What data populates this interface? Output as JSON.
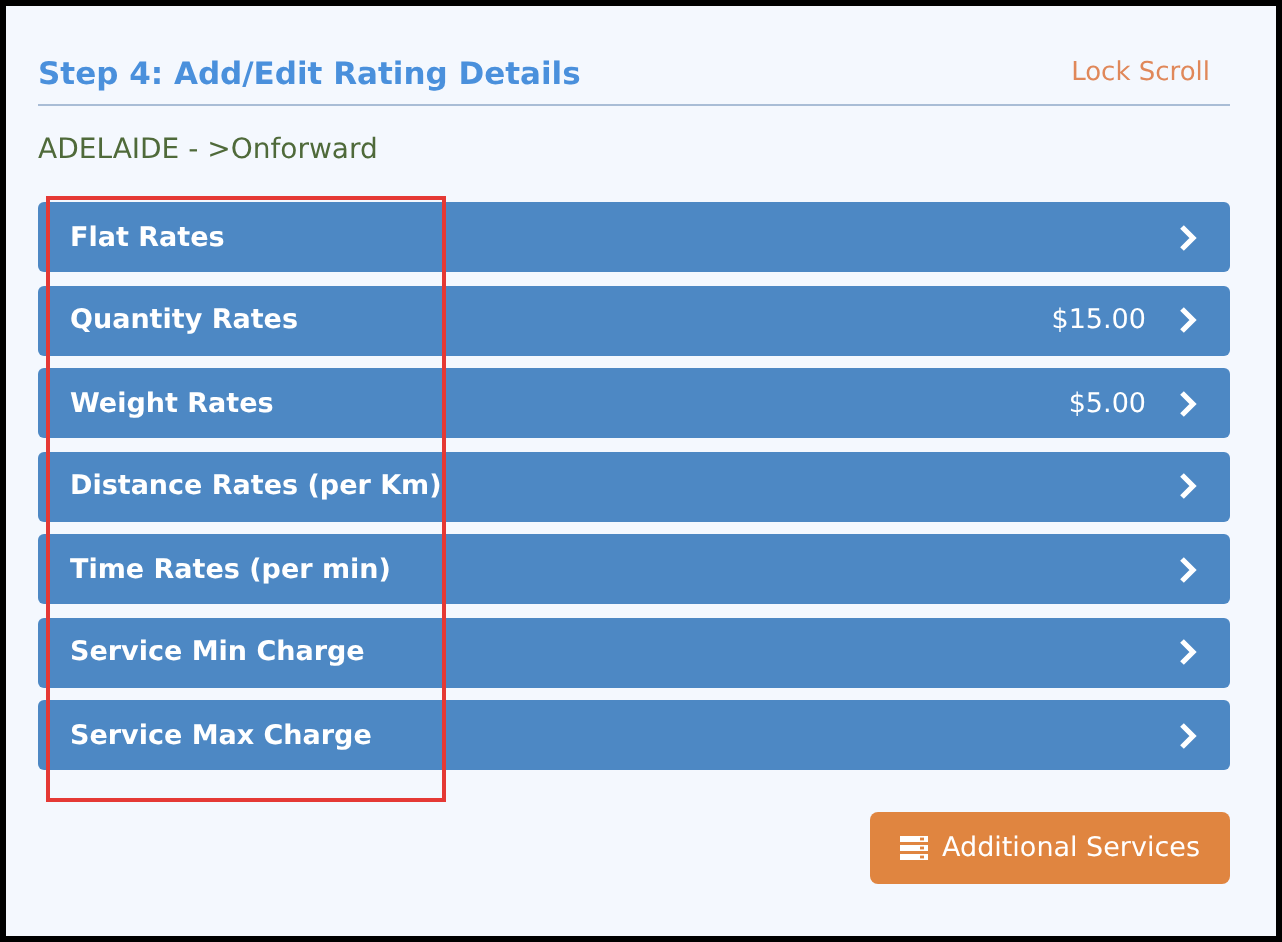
{
  "header": {
    "title": "Step 4: Add/Edit Rating Details",
    "action": "Lock Scroll"
  },
  "route": "ADELAIDE - >Onforward",
  "rates": [
    {
      "label": "Flat Rates"
    },
    {
      "label": "Quantity Rates",
      "amount": "$15.00"
    },
    {
      "label": "Weight Rates",
      "amount": "$5.00"
    },
    {
      "label": "Distance Rates (per Km)"
    },
    {
      "label": "Time Rates (per min)"
    },
    {
      "label": "Service Min Charge"
    },
    {
      "label": "Service Max Charge"
    }
  ],
  "footer_button": "Additional Services"
}
